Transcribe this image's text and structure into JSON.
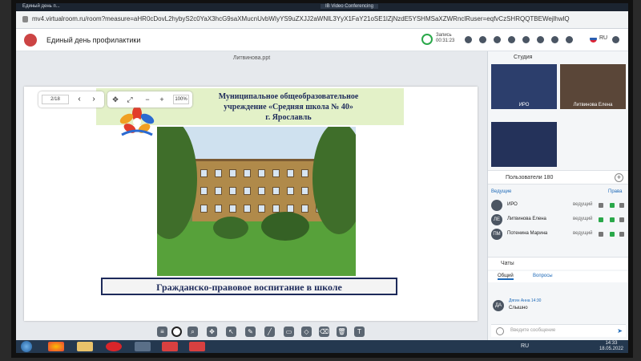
{
  "browser": {
    "tab_title": "Единый день п...",
    "center_tab": "IB Video Conferencing",
    "url": "mv4.virtualroom.ru/room?measure=aHR0cDovL2hybyS2c0YaX3hcG9saXMucnUvbWIyYS9uZXJJ2aWNlL3YyX1FaY21oSE1lZjNzdE5YSHMSaXZWRnclRuser=eqfvCzSHRQQTBEWejlhwlQ"
  },
  "header": {
    "title": "Единый день профилактики",
    "record_label": "Запись",
    "record_time": "00:31:23",
    "lang": "RU"
  },
  "presentation": {
    "file_name": "Литвинова.ppt",
    "page": "2/18",
    "zoom": "100%",
    "slide_title": "Муниципальное общеобразовательное\nучреждение «Средняя школа № 40»\nг. Ярославль",
    "slide_caption": "Гражданско-правовое воспитание в школе"
  },
  "studio": {
    "title": "Студия",
    "tiles": [
      {
        "label": "ИРО"
      },
      {
        "label": "Литвинова Елена"
      },
      {
        "label": ""
      }
    ]
  },
  "users": {
    "title": "Пользователи",
    "count": "180",
    "section": "Ведущие",
    "rights": "Права",
    "rows": [
      {
        "initials": "",
        "name": "ИРО",
        "role": "ведущий"
      },
      {
        "initials": "ЛЕ",
        "name": "Литвинова Елена",
        "role": "ведущий"
      },
      {
        "initials": "ПМ",
        "name": "Потенина Марина",
        "role": "ведущий"
      }
    ]
  },
  "chat": {
    "title": "Чаты",
    "tab_general": "Общий",
    "tab_questions": "Вопросы",
    "message": {
      "initials": "ДА",
      "author": "Дягин Анна 14:30",
      "text": "Слышно"
    },
    "input_placeholder": "Введите сообщение"
  },
  "taskbar": {
    "lang": "RU",
    "time": "14:33",
    "date": "18.05.2022"
  },
  "colors": {
    "accent": "#1e6ab8",
    "slide_title": "#1d2a5a",
    "record": "#2aa84a",
    "taskbar": "#24384f"
  }
}
